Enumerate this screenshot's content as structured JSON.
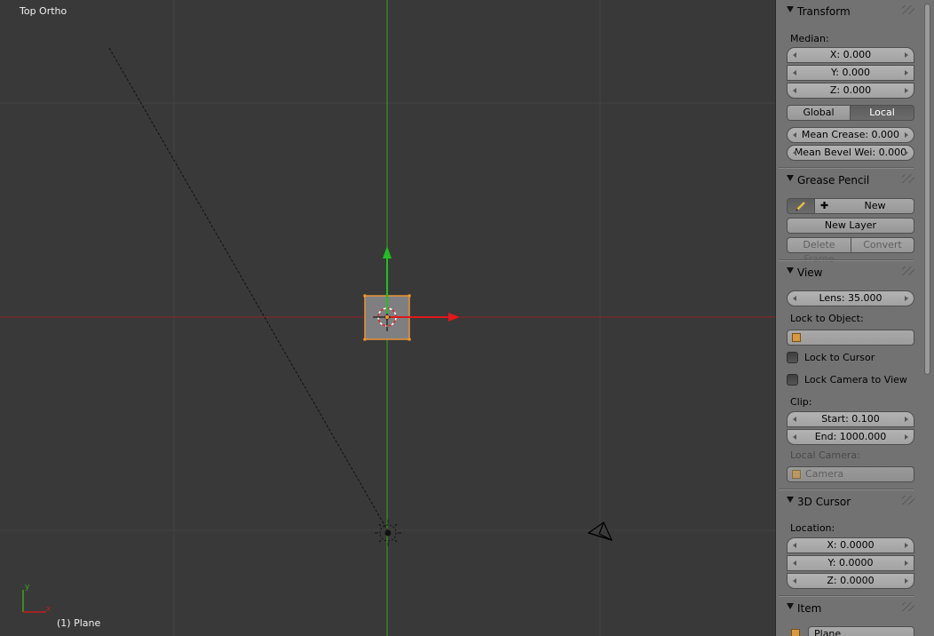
{
  "viewport": {
    "view_label": "Top Ortho",
    "object_label": "(1) Plane",
    "axis_y_label": "y",
    "axis_x_label": "x"
  },
  "panel": {
    "transform": {
      "title": "Transform",
      "median_label": "Median:",
      "x": "X: 0.000",
      "y": "Y: 0.000",
      "z": "Z: 0.000",
      "global_label": "Global",
      "local_label": "Local",
      "mean_crease": "Mean Crease: 0.000",
      "mean_bevel": "Mean Bevel Wei: 0.000"
    },
    "grease_pencil": {
      "title": "Grease Pencil",
      "new_label": "New",
      "new_layer_label": "New Layer",
      "delete_frame_label": "Delete Frame",
      "convert_label": "Convert"
    },
    "view": {
      "title": "View",
      "lens": "Lens: 35.000",
      "lock_to_object_label": "Lock to Object:",
      "lock_to_object_value": "",
      "lock_to_cursor_label": "Lock to Cursor",
      "lock_camera_label": "Lock Camera to View",
      "clip_label": "Clip:",
      "clip_start": "Start: 0.100",
      "clip_end": "End: 1000.000",
      "local_camera_label": "Local Camera:",
      "local_camera_value": "Camera"
    },
    "cursor": {
      "title": "3D Cursor",
      "location_label": "Location:",
      "x": "X: 0.0000",
      "y": "Y: 0.0000",
      "z": "Z: 0.0000"
    },
    "item": {
      "title": "Item",
      "name_value": "Plane"
    }
  },
  "colors": {
    "viewport_bg": "#393939",
    "grid_line": "#444444",
    "x_axis": "#9b2020",
    "y_axis": "#3a9a1e",
    "selection": "#f0932a",
    "panel_bg": "#727272"
  }
}
